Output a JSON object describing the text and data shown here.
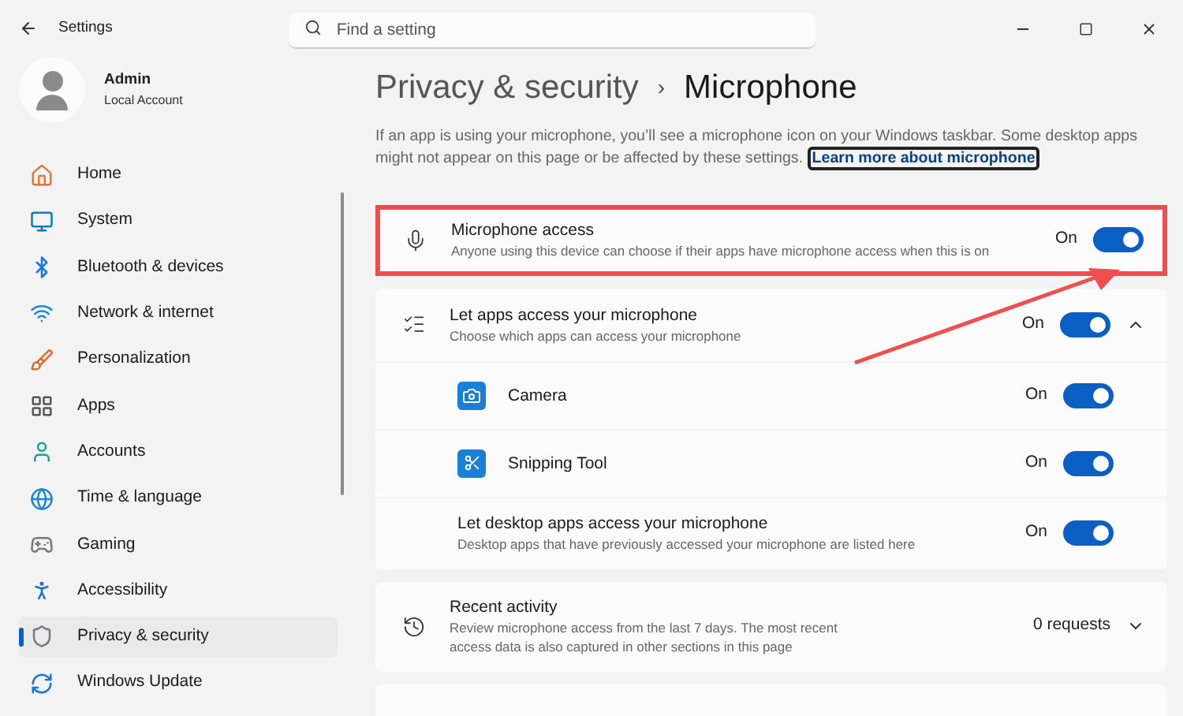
{
  "window": {
    "title": "Settings"
  },
  "search": {
    "placeholder": "Find a setting"
  },
  "account": {
    "name": "Admin",
    "type": "Local Account"
  },
  "sidebar": {
    "items": [
      {
        "label": "Home",
        "selected": false
      },
      {
        "label": "System",
        "selected": false
      },
      {
        "label": "Bluetooth & devices",
        "selected": false
      },
      {
        "label": "Network & internet",
        "selected": false
      },
      {
        "label": "Personalization",
        "selected": false
      },
      {
        "label": "Apps",
        "selected": false
      },
      {
        "label": "Accounts",
        "selected": false
      },
      {
        "label": "Time & language",
        "selected": false
      },
      {
        "label": "Gaming",
        "selected": false
      },
      {
        "label": "Accessibility",
        "selected": false
      },
      {
        "label": "Privacy & security",
        "selected": true
      },
      {
        "label": "Windows Update",
        "selected": false
      }
    ]
  },
  "breadcrumb": {
    "parent": "Privacy & security",
    "separator": "›",
    "current": "Microphone"
  },
  "intro": {
    "text": "If an app is using your microphone, you’ll see a microphone icon on your Windows taskbar. Some desktop apps might not appear on this page or be affected by these settings.",
    "link": "Learn more about microphone"
  },
  "cards": [
    {
      "kind": "setting",
      "title": "Microphone access",
      "description": "Anyone using this device can choose if their apps have microphone access when this is on",
      "state": "On",
      "on": true,
      "highlighted": true
    },
    {
      "kind": "group",
      "title": "Let apps access your microphone",
      "description": "Choose which apps can access your microphone",
      "state": "On",
      "on": true,
      "expanded": true,
      "children": [
        {
          "kind": "app",
          "title": "Camera",
          "state": "On",
          "on": true
        },
        {
          "kind": "app",
          "title": "Snipping Tool",
          "state": "On",
          "on": true
        },
        {
          "kind": "setting",
          "title": "Let desktop apps access your microphone",
          "description": "Desktop apps that have previously accessed your microphone are listed here",
          "state": "On",
          "on": true
        }
      ]
    },
    {
      "kind": "activity",
      "title": "Recent activity",
      "description": "Review microphone access from the last 7 days. The most recent access data is also captured in other sections in this page",
      "state": "0 requests",
      "expanded": false
    },
    {
      "kind": "empty"
    }
  ]
}
